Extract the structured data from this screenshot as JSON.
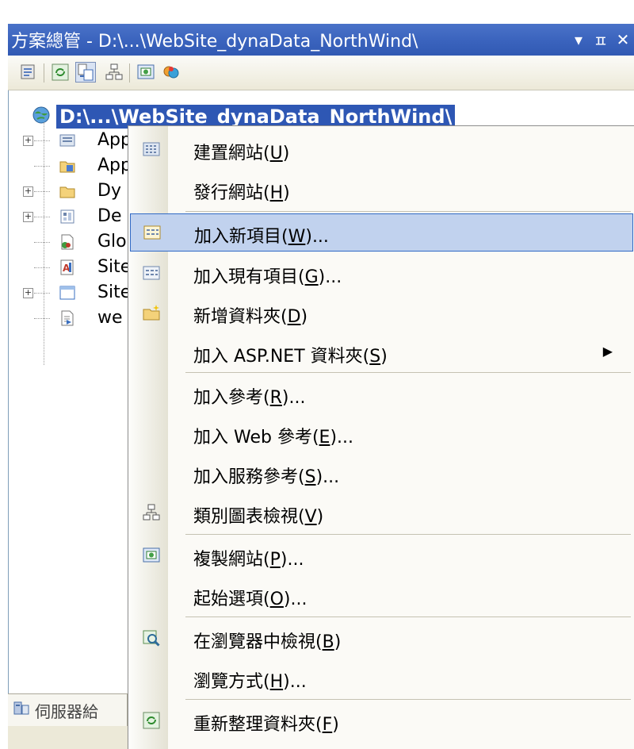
{
  "title_bar": {
    "title": "方案總管 - D:\\...\\WebSite_dynaData_NorthWind\\",
    "dropdown_glyph": "▾",
    "pin_glyph": "ㅍ",
    "close_glyph": "✕"
  },
  "toolbar": {
    "buttons": [
      "properties-icon",
      "refresh-icon",
      "nest-related-files-icon",
      "class-diagram-icon",
      "copy-website-icon",
      "asp-net-configuration-icon"
    ]
  },
  "tree": {
    "root_label": "D:\\...\\WebSite_dynaData_NorthWind\\",
    "items": [
      {
        "label": "App",
        "icon": "app-code-folder-icon",
        "expandable": true
      },
      {
        "label": "App",
        "icon": "app-data-folder-icon",
        "expandable": false
      },
      {
        "label": "Dy",
        "icon": "folder-icon",
        "expandable": true
      },
      {
        "label": "De",
        "icon": "page-icon",
        "expandable": true
      },
      {
        "label": "Glo",
        "icon": "global-asax-icon",
        "expandable": false
      },
      {
        "label": "Site",
        "icon": "stylesheet-icon",
        "expandable": false
      },
      {
        "label": "Site",
        "icon": "master-page-icon",
        "expandable": true
      },
      {
        "label": "we",
        "icon": "web-config-icon",
        "expandable": false
      }
    ]
  },
  "bottom_tab": {
    "label": "伺服器給"
  },
  "context_menu": {
    "items": [
      {
        "pre": "建置網站(",
        "key": "U",
        "post": ")",
        "icon": "build-website-icon"
      },
      {
        "pre": "發行網站(",
        "key": "H",
        "post": ")",
        "icon": ""
      },
      {
        "pre": "加入新項目(",
        "key": "W",
        "post": ")...",
        "icon": "add-new-item-icon",
        "highlighted": true
      },
      {
        "pre": "加入現有項目(",
        "key": "G",
        "post": ")...",
        "icon": "add-existing-item-icon"
      },
      {
        "pre": "新增資料夾(",
        "key": "D",
        "post": ")",
        "icon": "new-folder-icon"
      },
      {
        "pre": "加入 ASP.NET 資料夾(",
        "key": "S",
        "post": ")",
        "icon": "",
        "submenu": true
      },
      {
        "pre": "加入參考(",
        "key": "R",
        "post": ")...",
        "icon": ""
      },
      {
        "pre": "加入 Web 參考(",
        "key": "E",
        "post": ")...",
        "icon": ""
      },
      {
        "pre": "加入服務參考(",
        "key": "S",
        "post": ")...",
        "icon": ""
      },
      {
        "pre": "類別圖表檢視(",
        "key": "V",
        "post": ")",
        "icon": "class-diagram-icon"
      },
      {
        "pre": "複製網站(",
        "key": "P",
        "post": ")...",
        "icon": "copy-website-icon"
      },
      {
        "pre": "起始選項(",
        "key": "O",
        "post": ")...",
        "icon": ""
      },
      {
        "pre": "在瀏覽器中檢視(",
        "key": "B",
        "post": ")",
        "icon": "view-in-browser-icon"
      },
      {
        "pre": "瀏覽方式(",
        "key": "H",
        "post": ")...",
        "icon": ""
      },
      {
        "pre": "重新整理資料夾(",
        "key": "F",
        "post": ")",
        "icon": "refresh-folder-icon"
      }
    ],
    "submenu_arrow": "▶"
  }
}
